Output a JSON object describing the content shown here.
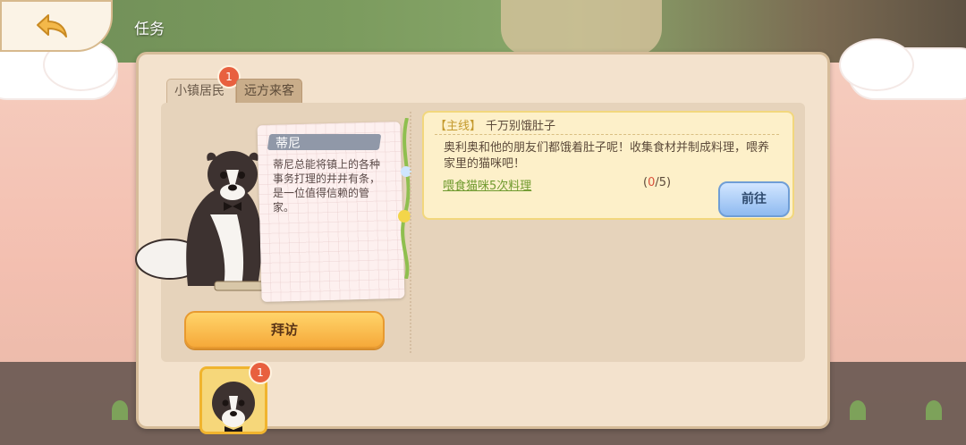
{
  "header": {
    "title": "任务"
  },
  "tabs": [
    {
      "label": "小镇居民",
      "badge": "1",
      "active": true
    },
    {
      "label": "远方来客",
      "active": false
    }
  ],
  "character": {
    "name": "蒂尼",
    "description": "蒂尼总能将镇上的各种事务打理的井井有条，是一位值得信赖的管家。",
    "visit_label": "拜访"
  },
  "quest": {
    "tag": "【主线】",
    "name": "千万别饿肚子",
    "description": "奥利奥和他的朋友们都饿着肚子呢！收集食材并制成料理，喂养家里的猫咪吧！",
    "task": "喂食猫咪5次料理",
    "progress_open": "(",
    "progress_current": "0",
    "progress_total": "/5)",
    "go_label": "前往"
  },
  "bottom": {
    "avatar_badge": "1"
  },
  "colors": {
    "accent": "#f6a93a",
    "badge": "#e8603f",
    "task": "#6f9a2f"
  }
}
